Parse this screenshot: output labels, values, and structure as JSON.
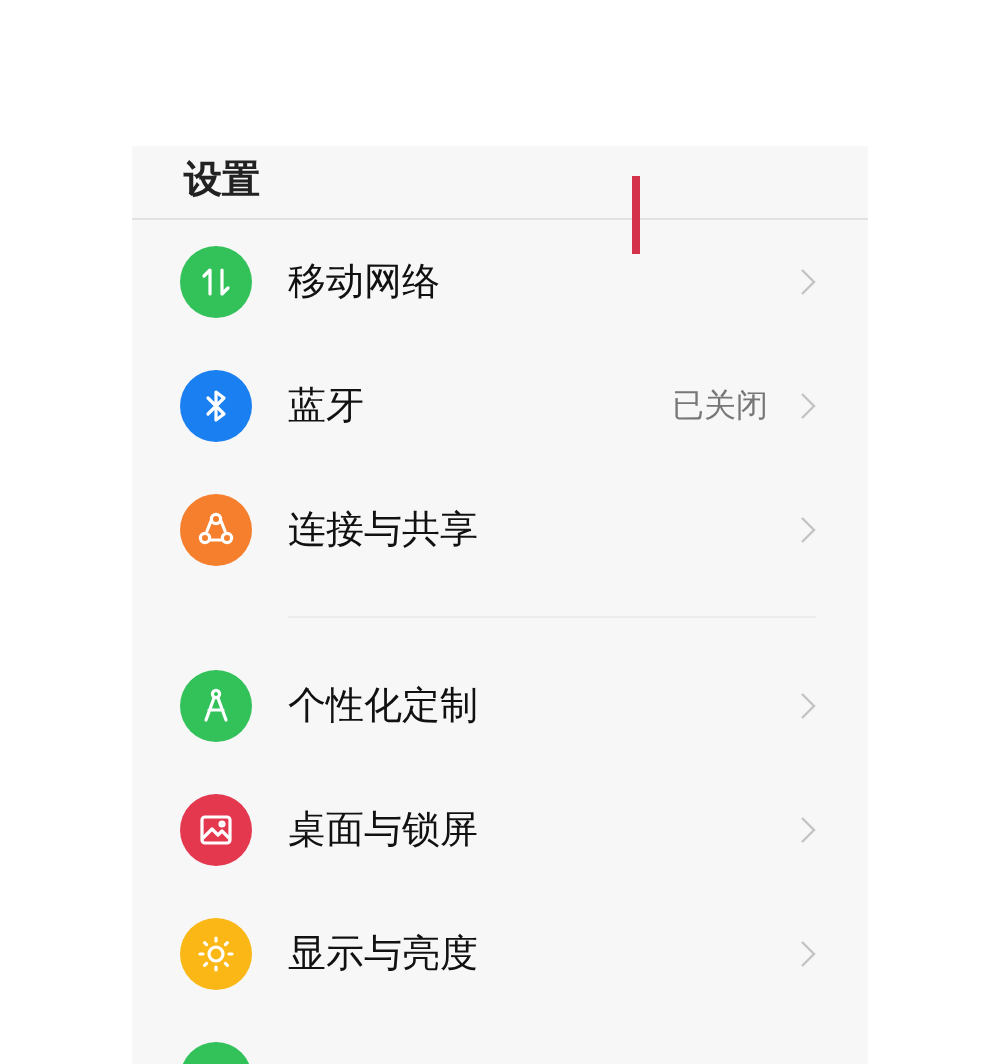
{
  "header": {
    "title": "设置"
  },
  "sections": [
    {
      "items": [
        {
          "kind": "arrows",
          "color": "#33c25a",
          "label": "移动网络"
        },
        {
          "kind": "bluetooth",
          "color": "#1a7ff0",
          "label": "蓝牙",
          "value": "已关闭"
        },
        {
          "kind": "share",
          "color": "#f57f2c",
          "label": "连接与共享"
        }
      ]
    },
    {
      "items": [
        {
          "kind": "compass",
          "color": "#33c25a",
          "label": "个性化定制"
        },
        {
          "kind": "picture",
          "color": "#e4384f",
          "label": "桌面与锁屏"
        },
        {
          "kind": "sun",
          "color": "#fbb716",
          "label": "显示与亮度"
        },
        {
          "kind": "blank",
          "color": "#33c25a"
        }
      ]
    }
  ]
}
